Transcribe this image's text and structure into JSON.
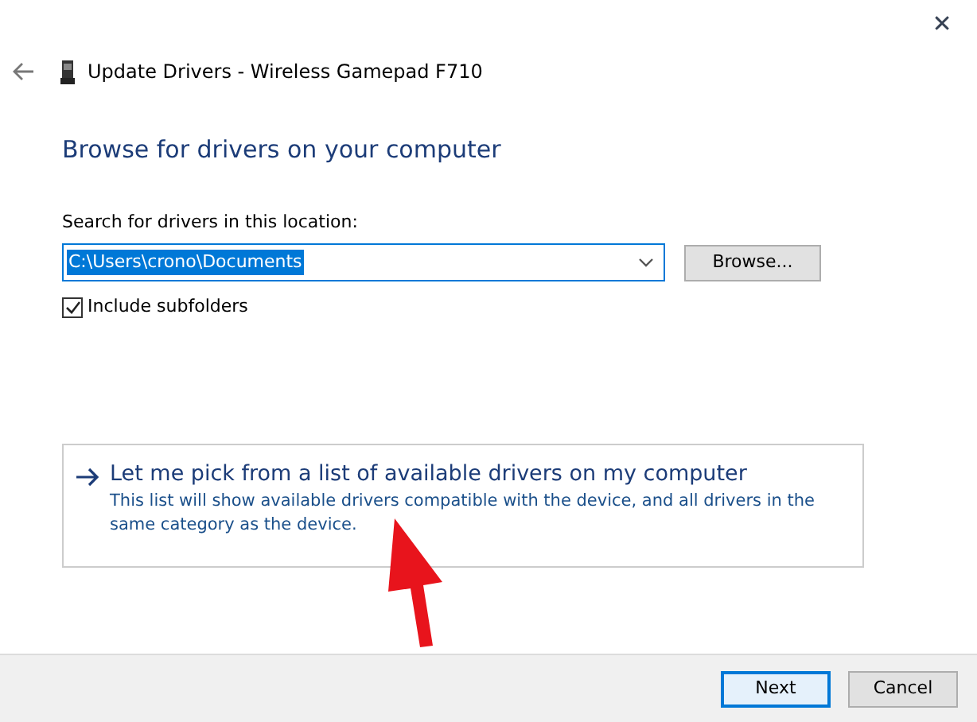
{
  "window": {
    "title": "Update Drivers - Wireless Gamepad F710",
    "close": "✕"
  },
  "heading": "Browse for drivers on your computer",
  "search": {
    "label": "Search for drivers in this location:",
    "value": "C:\\Users\\crono\\Documents",
    "text_selected": true
  },
  "browse_button": "Browse...",
  "include_subfolders": {
    "label": "Include subfolders",
    "checked": true
  },
  "option": {
    "title": "Let me pick from a list of available drivers on my computer",
    "description": "This list will show available drivers compatible with the device, and all drivers in the same category as the device."
  },
  "buttons": [
    {
      "label": "Next",
      "default": true
    },
    {
      "label": "Cancel",
      "default": false
    }
  ]
}
